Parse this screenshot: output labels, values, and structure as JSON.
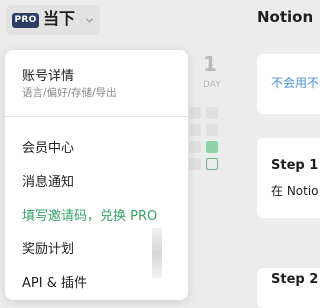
{
  "account": {
    "badge": "PRO",
    "name": "当下"
  },
  "main": {
    "title": "Notion |",
    "day_number": "1",
    "day_label": "DAY",
    "notice_link": "不会用不",
    "step1": {
      "title": "Step 1",
      "text": "在 Notio"
    },
    "step2": {
      "title": "Step 2"
    }
  },
  "menu": {
    "account_details": {
      "title": "账号详情",
      "subtitle": "语言/偏好/存储/导出"
    },
    "items": [
      {
        "label": "会员中心"
      },
      {
        "label": "消息通知"
      },
      {
        "label": "填写邀请码，兑换 PRO"
      },
      {
        "label": "奖励计划"
      },
      {
        "label": "API & 插件"
      }
    ]
  },
  "colors": {
    "accent_green": "#34a366",
    "link_blue": "#4a90d9",
    "badge_navy": "#2c3e66"
  }
}
